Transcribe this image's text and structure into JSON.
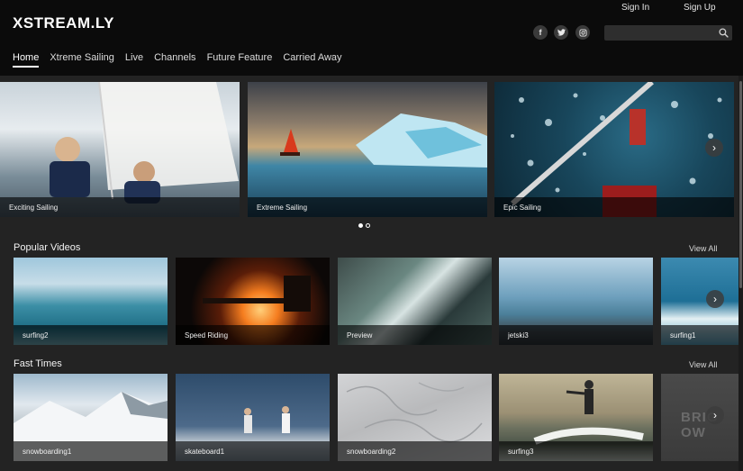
{
  "header": {
    "logo": "XSTREAM.LY",
    "sign_in": "Sign In",
    "sign_up": "Sign Up",
    "social": [
      {
        "icon": "facebook-icon",
        "glyph": "f"
      },
      {
        "icon": "twitter-icon",
        "glyph": "t"
      },
      {
        "icon": "instagram-icon",
        "glyph": "◎"
      }
    ],
    "search": {
      "placeholder": "",
      "value": ""
    },
    "nav": [
      "Home",
      "Xtreme Sailing",
      "Live",
      "Channels",
      "Future Feature",
      "Carried Away"
    ],
    "active_nav": "Home"
  },
  "hero": {
    "items": [
      {
        "caption": "Exciting Sailing"
      },
      {
        "caption": "Extreme Sailing"
      },
      {
        "caption": "Epic Sailing"
      }
    ],
    "next_arrow": "›",
    "pagination": {
      "pages": 2,
      "active": 1
    }
  },
  "rows": [
    {
      "title": "Popular Videos",
      "view_all": "View All",
      "items": [
        {
          "caption": "surfing2"
        },
        {
          "caption": "Speed Riding"
        },
        {
          "caption": "Preview"
        },
        {
          "caption": "jetski3"
        },
        {
          "caption": "surfing1"
        }
      ]
    },
    {
      "title": "Fast Times",
      "view_all": "View All",
      "items": [
        {
          "caption": "snowboarding1"
        },
        {
          "caption": "skateboard1"
        },
        {
          "caption": "snowboarding2"
        },
        {
          "caption": "surfing3"
        },
        {
          "caption": "",
          "overlay_text": "BRIG  OW"
        }
      ]
    }
  ],
  "colors": {
    "header_bg": "#0b0b0b",
    "page_bg": "#232323",
    "caption_bg": "rgba(0,0,0,0.62)"
  }
}
